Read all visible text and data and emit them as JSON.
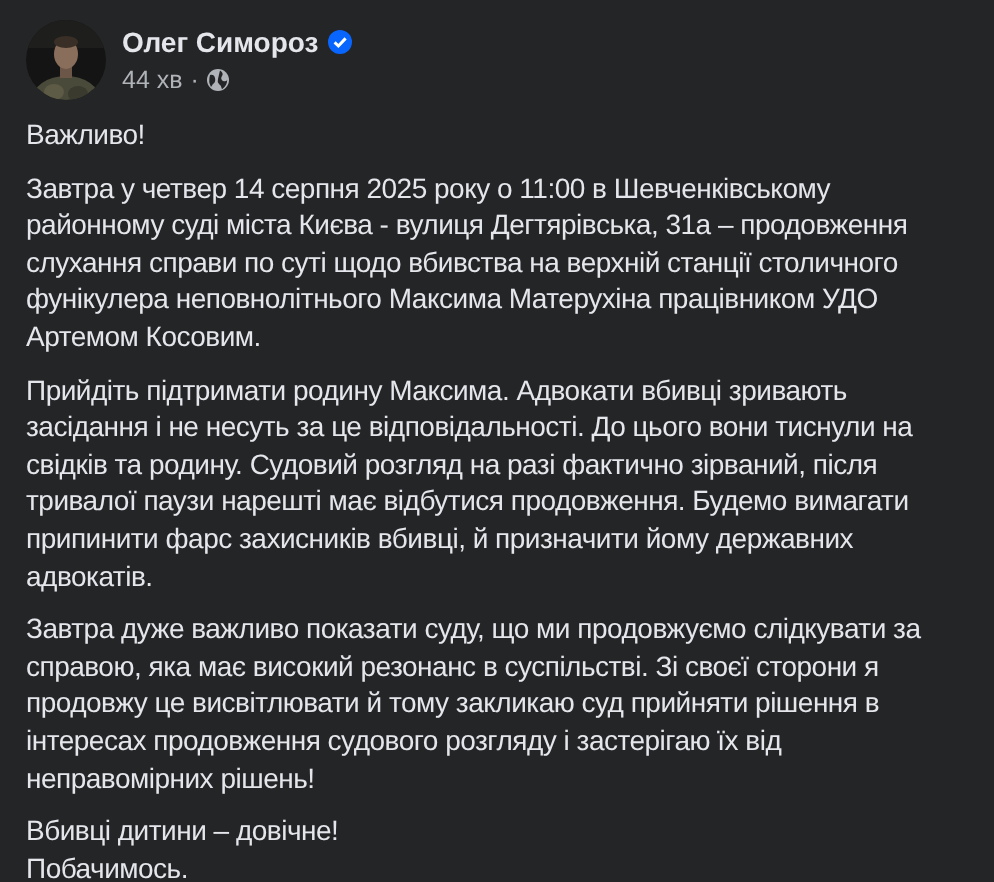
{
  "post": {
    "author": "Олег Симороз",
    "verified": true,
    "time": "44 хв",
    "separator": "·",
    "paragraphs": [
      {
        "lines": [
          "Важливо!"
        ]
      },
      {
        "lines": [
          "Завтра у четвер 14 серпня 2025 року о 11:00 в Шевченківському районному суді міста Києва - вулиця Дегтярівська, 31а – продовження слухання справи по суті щодо вбивства на верхній станції столичного фунікулера неповнолітнього Максима Матерухіна працівником УДО Артемом Косовим."
        ]
      },
      {
        "lines": [
          "Прийдіть підтримати родину Максима. Адвокати вбивці зривають засідання і не несуть за це відповідальності. До цього вони тиснули на свідків та родину. Судовий розгляд на разі фактично зірваний, після тривалої паузи нарешті має відбутися продовження. Будемо вимагати припинити фарс захисників вбивці, й призначити йому державних адвокатів."
        ]
      },
      {
        "lines": [
          "Завтра дуже важливо показати суду, що ми продовжуємо слідкувати за справою, яка має високий резонанс в суспільстві. Зі своєї сторони я продовжу це висвітлювати й тому закликаю суд прийняти рішення в інтересах продовження судового розгляду і застерігаю їх від неправомірних рішень!"
        ]
      },
      {
        "lines": [
          "Вбивці дитини – довічне!",
          "Побачимось."
        ]
      }
    ]
  }
}
